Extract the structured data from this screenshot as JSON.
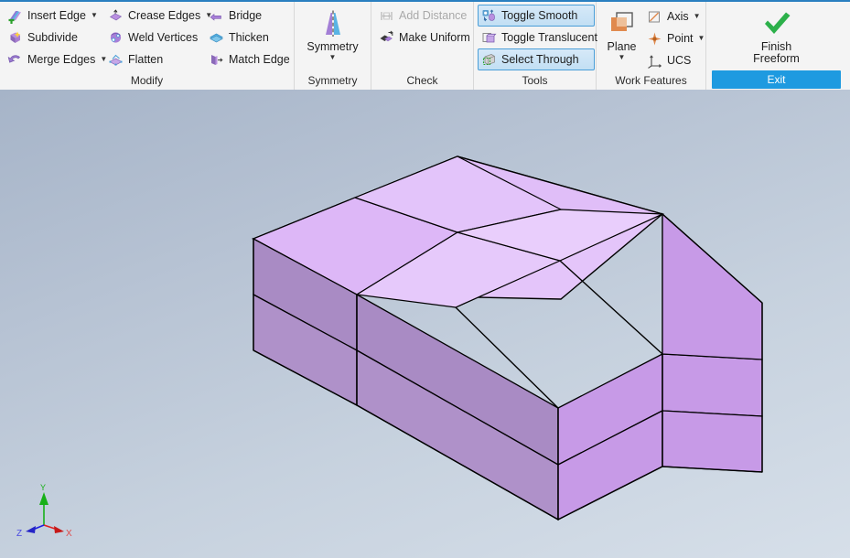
{
  "app": {
    "theme_accent": "#1e9ae0",
    "ribbon_bg": "#f4f4f4"
  },
  "ribbon": {
    "panels": [
      {
        "name": "modify",
        "label": "Modify",
        "label_highlight": false,
        "columns": [
          {
            "items": [
              {
                "label": "Insert Edge",
                "icon": "insert-edge-icon",
                "dropdown": true,
                "state": "normal"
              },
              {
                "label": "Subdivide",
                "icon": "subdivide-icon",
                "dropdown": false,
                "state": "normal"
              },
              {
                "label": "Merge Edges",
                "icon": "merge-edges-icon",
                "dropdown": true,
                "state": "normal"
              }
            ]
          },
          {
            "items": [
              {
                "label": "Crease Edges",
                "icon": "crease-edges-icon",
                "dropdown": true,
                "state": "normal"
              },
              {
                "label": "Weld Vertices",
                "icon": "weld-vertices-icon",
                "dropdown": false,
                "state": "normal"
              },
              {
                "label": "Flatten",
                "icon": "flatten-icon",
                "dropdown": false,
                "state": "normal"
              }
            ]
          },
          {
            "items": [
              {
                "label": "Bridge",
                "icon": "bridge-icon",
                "dropdown": false,
                "state": "normal"
              },
              {
                "label": "Thicken",
                "icon": "thicken-icon",
                "dropdown": false,
                "state": "normal"
              },
              {
                "label": "Match Edge",
                "icon": "match-edge-icon",
                "dropdown": false,
                "state": "normal"
              }
            ]
          }
        ]
      },
      {
        "name": "symmetry",
        "label": "Symmetry",
        "label_highlight": false,
        "big_button": {
          "label": "Symmetry",
          "icon": "symmetry-icon",
          "dropdown": true,
          "state": "normal"
        }
      },
      {
        "name": "check",
        "label": "Check",
        "label_highlight": false,
        "columns": [
          {
            "items": [
              {
                "label": "Add Distance",
                "icon": "add-distance-icon",
                "dropdown": false,
                "state": "disabled"
              },
              {
                "label": "Make Uniform",
                "icon": "make-uniform-icon",
                "dropdown": false,
                "state": "normal"
              }
            ]
          }
        ]
      },
      {
        "name": "tools",
        "label": "Tools",
        "label_highlight": false,
        "columns": [
          {
            "items": [
              {
                "label": "Toggle Smooth",
                "icon": "toggle-smooth-icon",
                "dropdown": false,
                "state": "active"
              },
              {
                "label": "Toggle Translucent",
                "icon": "toggle-translucent-icon",
                "dropdown": false,
                "state": "normal"
              },
              {
                "label": "Select Through",
                "icon": "select-through-icon",
                "dropdown": false,
                "state": "active"
              }
            ]
          }
        ]
      },
      {
        "name": "work-features",
        "label": "Work Features",
        "label_highlight": false,
        "big_button": {
          "label": "Plane",
          "icon": "plane-icon",
          "dropdown": true,
          "state": "normal"
        },
        "columns": [
          {
            "items": [
              {
                "label": "Axis",
                "icon": "axis-icon",
                "dropdown": true,
                "state": "normal"
              },
              {
                "label": "Point",
                "icon": "point-icon",
                "dropdown": true,
                "state": "normal"
              },
              {
                "label": "UCS",
                "icon": "ucs-icon",
                "dropdown": false,
                "state": "normal"
              }
            ]
          }
        ]
      },
      {
        "name": "exit",
        "label": "Exit",
        "label_highlight": true,
        "big_button": {
          "label": "Finish\nFreeform",
          "label_line1": "Finish",
          "label_line2": "Freeform",
          "icon": "checkmark-icon",
          "dropdown": false,
          "state": "normal"
        }
      }
    ]
  },
  "viewport": {
    "name": "3d-viewport",
    "background_top": "#a6b4c8",
    "background_bottom": "#d6dfe9",
    "model": {
      "name": "freeform-box",
      "top_face_color": "#dda8f5",
      "front_left_face_color": "#b58bc9",
      "front_right_face_color": "#c89ae8",
      "edge_color": "#000000",
      "subdivisions": "2 x 2 x 2",
      "description": "Freeform box subdivided into 2 columns, 2 rows and 2 layers"
    },
    "axis_indicator": {
      "name": "coordinate-axis-triad",
      "x_label": "X",
      "x_color": "#e02020",
      "y_label": "Y",
      "y_color": "#18b018",
      "z_label": "Z",
      "z_color": "#2020e0"
    }
  }
}
